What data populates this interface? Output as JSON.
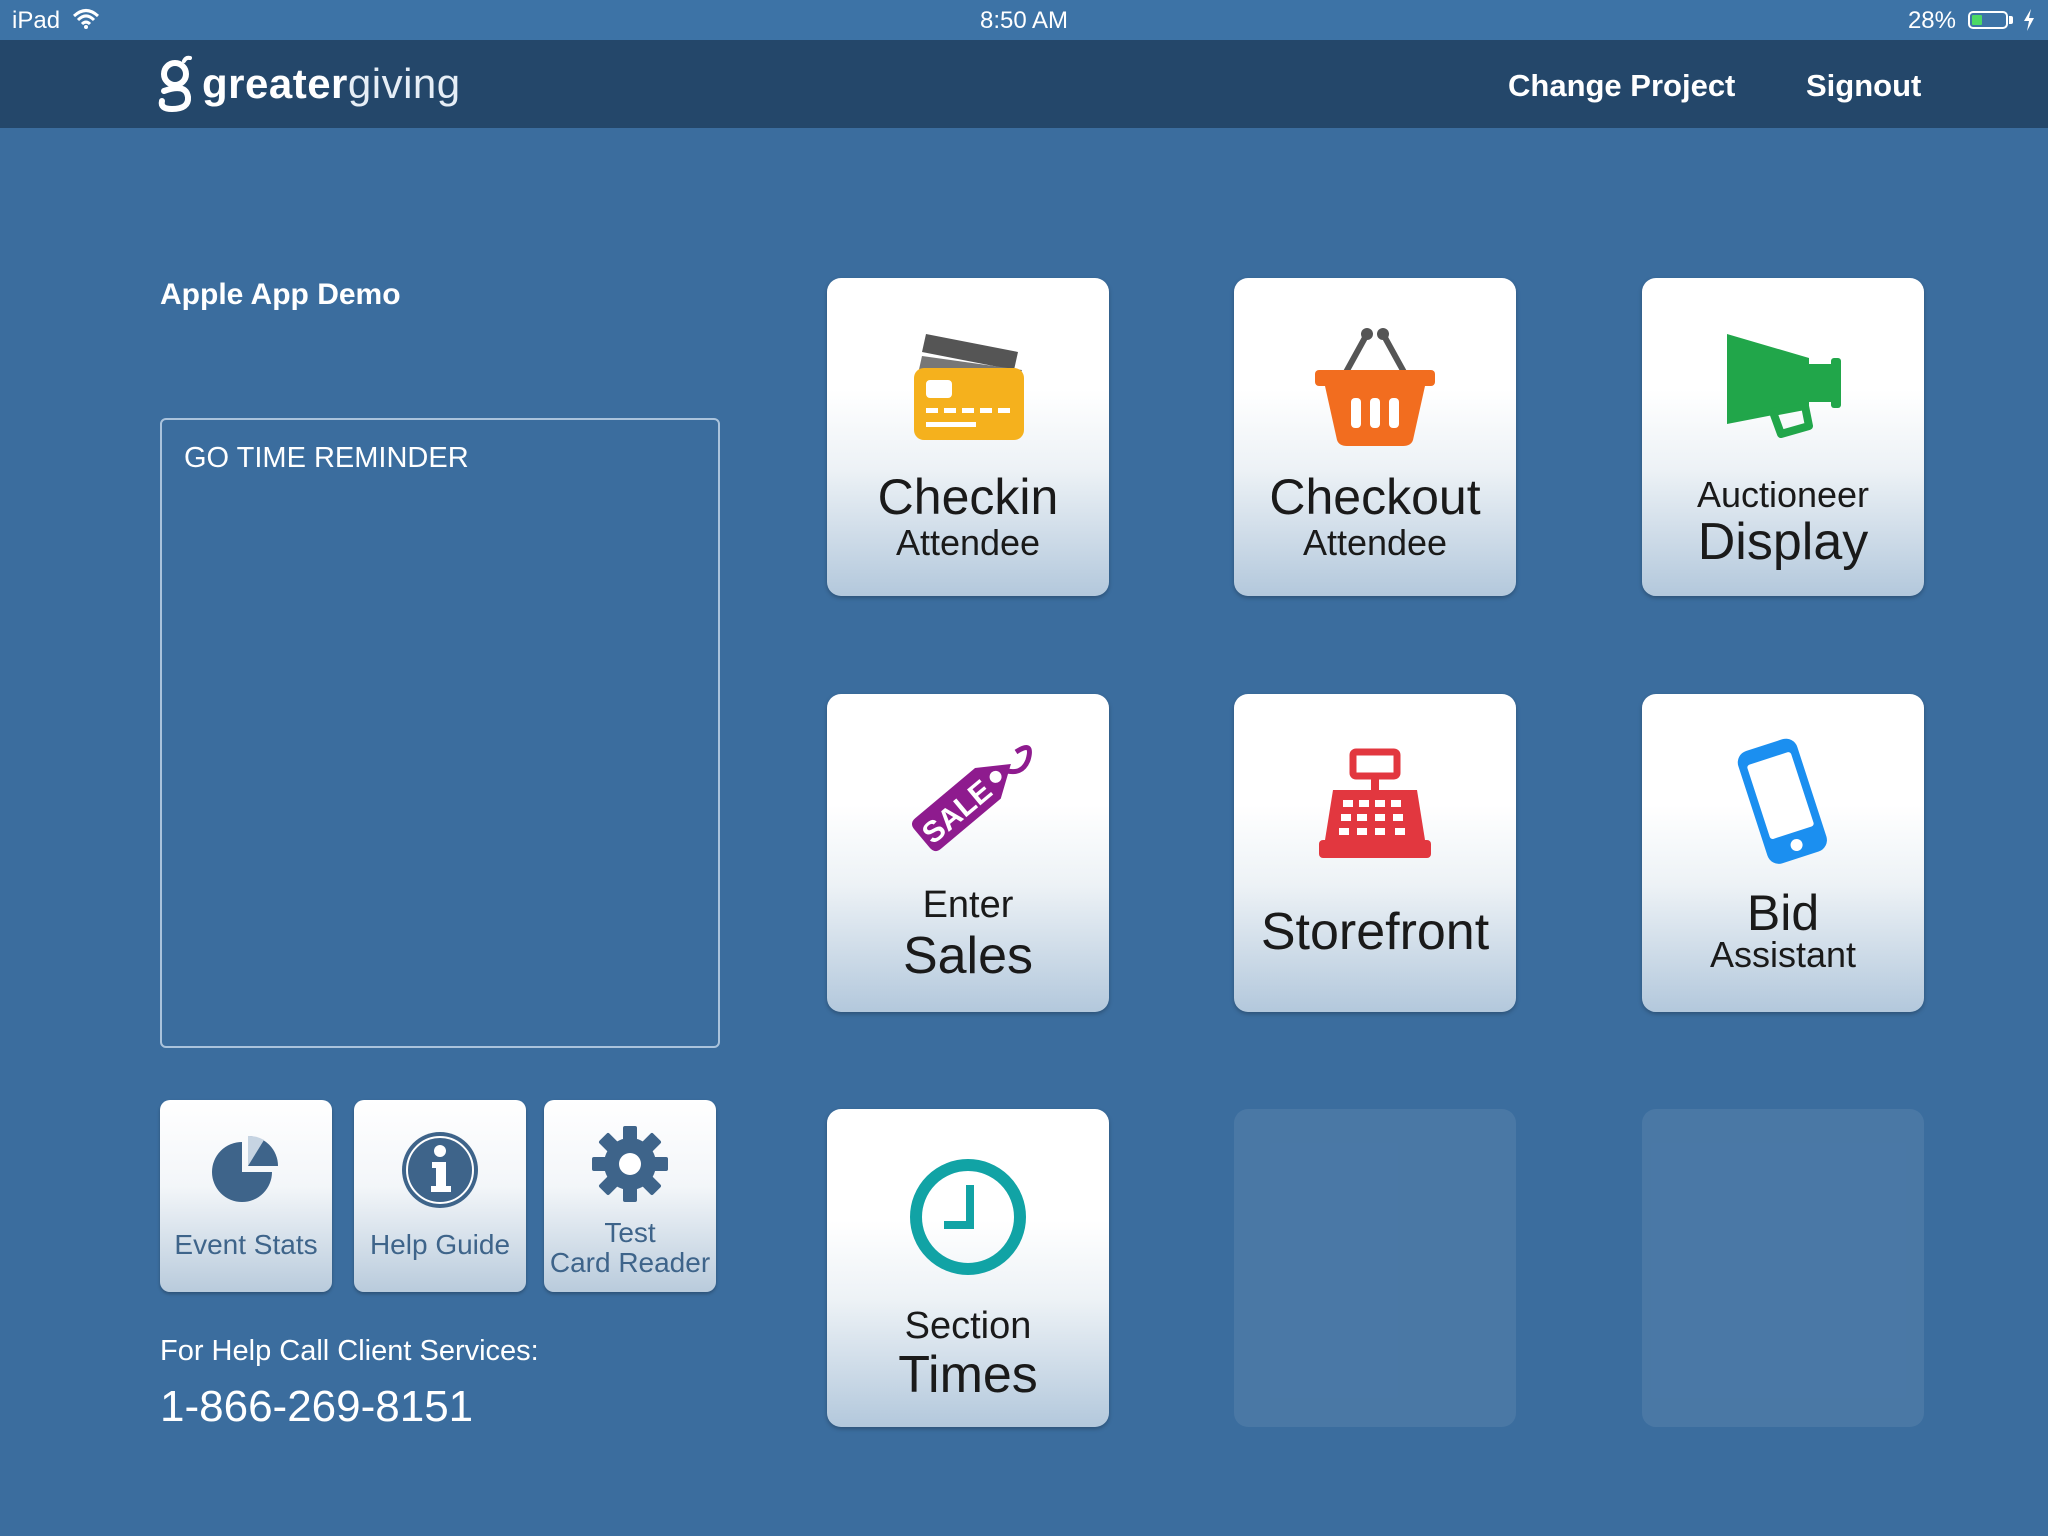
{
  "status_bar": {
    "device": "iPad",
    "time": "8:50 AM",
    "battery": "28%",
    "battery_level": 0.28
  },
  "header": {
    "logo_bold": "greater",
    "logo_light": "giving",
    "change_project": "Change Project",
    "signout": "Signout"
  },
  "sidebar": {
    "project_name": "Apple App Demo",
    "reminder_title": "GO TIME REMINDER",
    "tools": [
      {
        "label": "Event Stats",
        "icon": "pie-chart-icon"
      },
      {
        "label": "Help Guide",
        "icon": "info-icon"
      },
      {
        "label_line1": "Test",
        "label_line2": "Card Reader",
        "icon": "gear-icon"
      }
    ],
    "help_label": "For Help Call Client Services:",
    "help_phone": "1-866-269-8151"
  },
  "tiles": [
    {
      "line1": "Checkin",
      "line2": "Attendee",
      "icon": "credit-card-icon",
      "color": "#f5b11d"
    },
    {
      "line1": "Checkout",
      "line2": "Attendee",
      "icon": "basket-icon",
      "color": "#f26d1f"
    },
    {
      "line1": "Auctioneer",
      "line2": "Display",
      "icon": "megaphone-icon",
      "color": "#21a64a"
    },
    {
      "line1": "Enter",
      "line2": "Sales",
      "icon": "sale-tag-icon",
      "tag_text": "SALE",
      "color": "#8e1b8e"
    },
    {
      "line1": "Storefront",
      "icon": "cash-register-icon",
      "color": "#e2373f"
    },
    {
      "line1": "Bid",
      "line2": "Assistant",
      "icon": "phone-icon",
      "color": "#1b8ff0"
    },
    {
      "line1": "Section",
      "line2": "Times",
      "icon": "clock-icon",
      "color": "#11a3a5"
    }
  ],
  "colors": {
    "background": "#3b6d9e",
    "nav": "#24476a",
    "tool_text": "#3e648a"
  }
}
